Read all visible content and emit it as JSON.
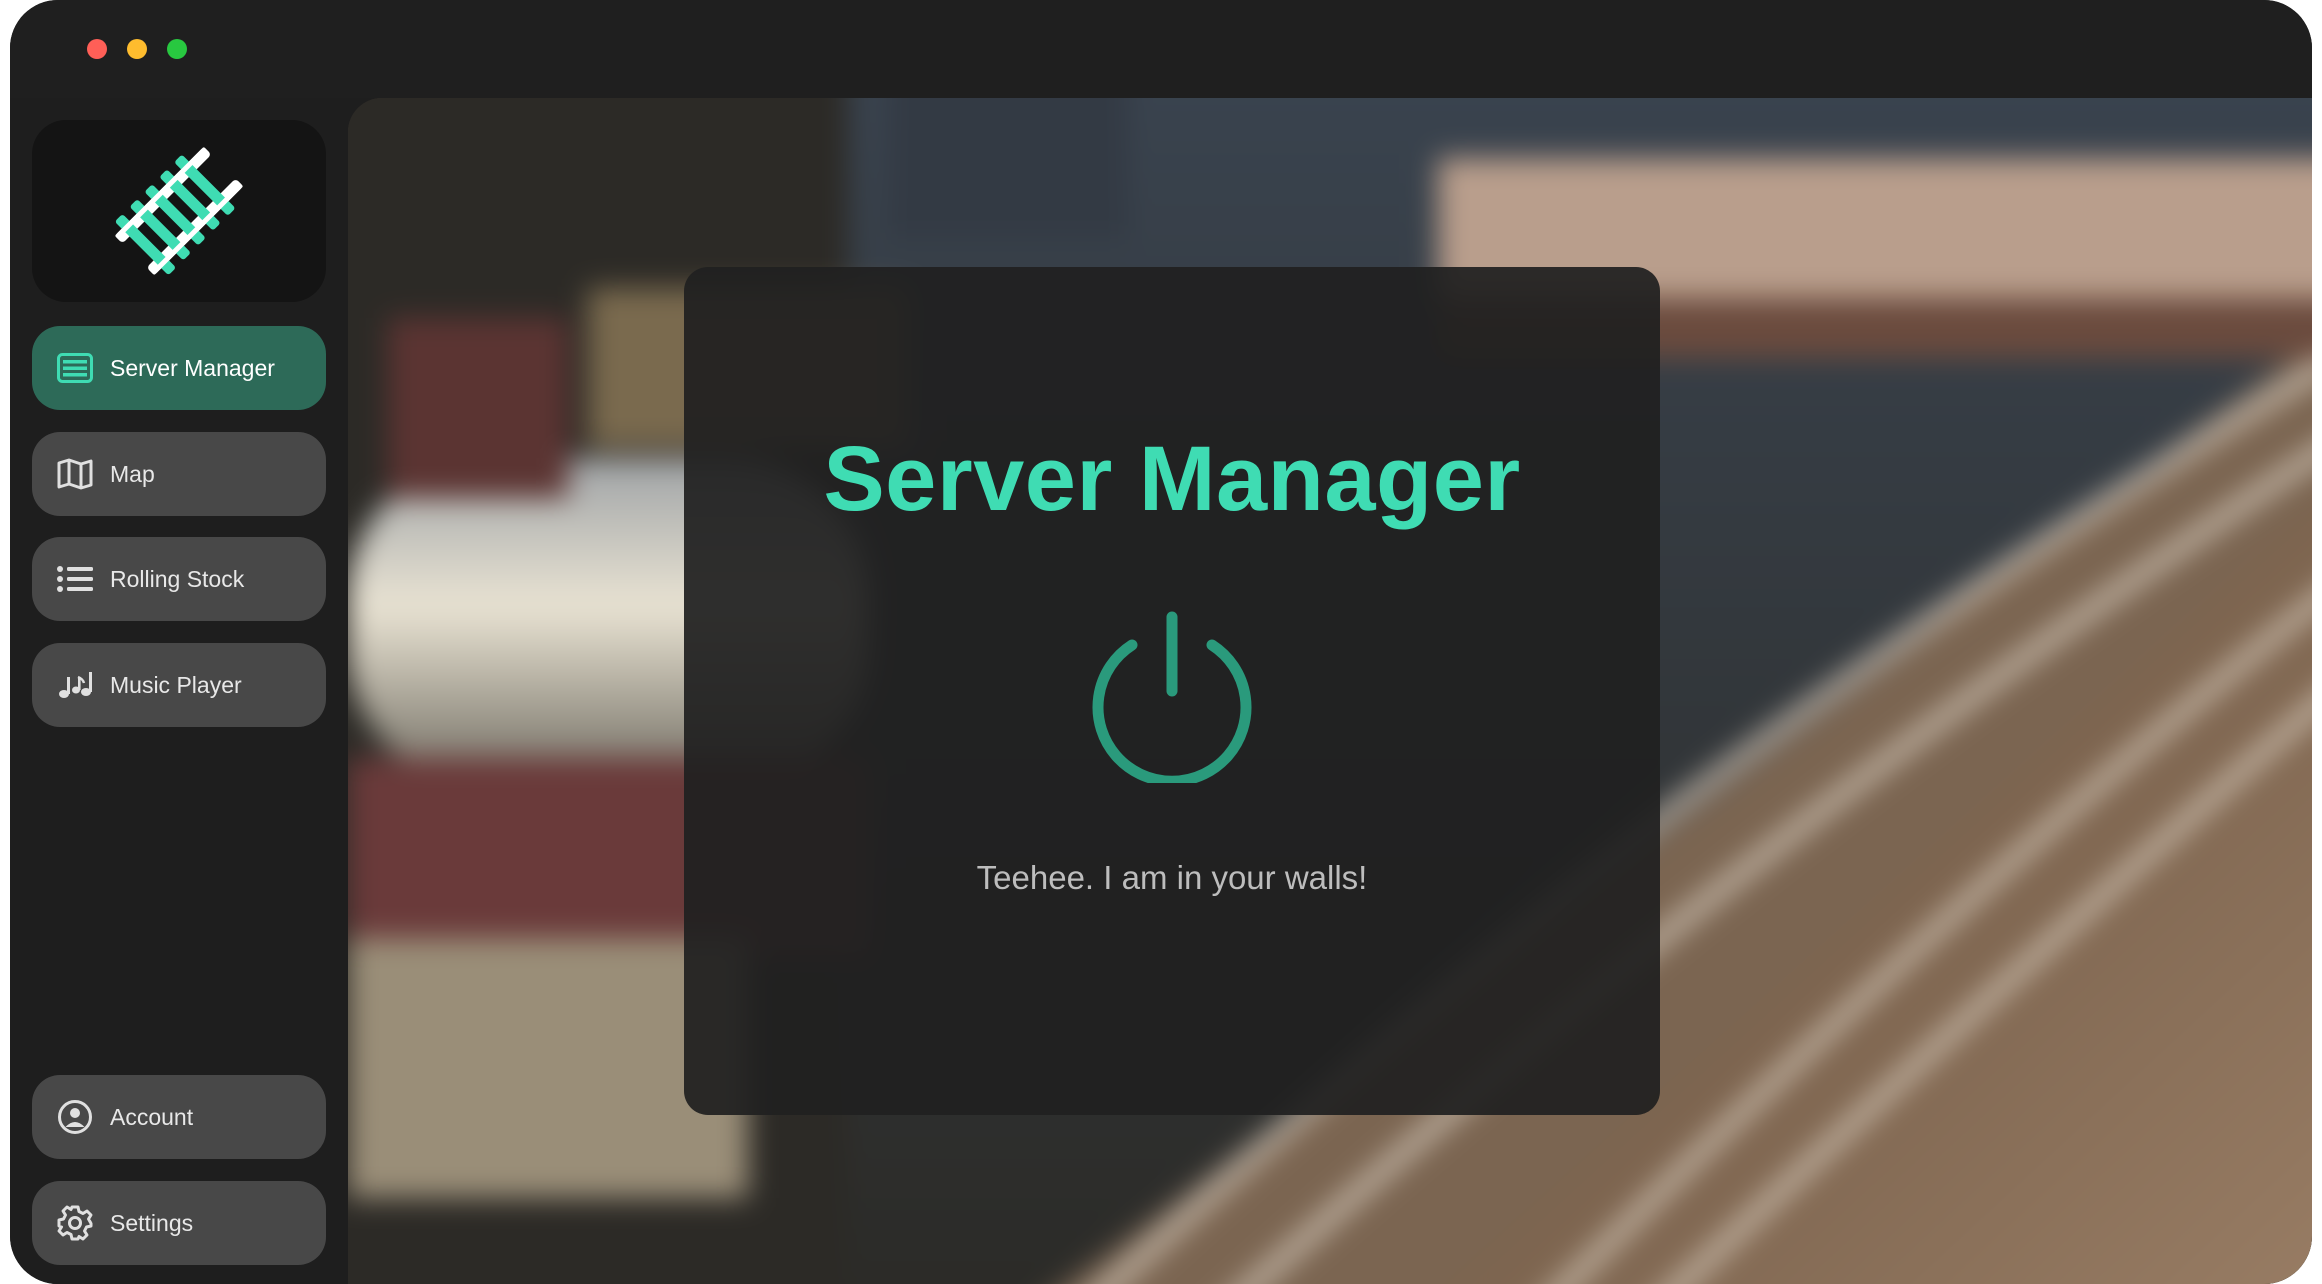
{
  "window": {
    "controls": [
      "close",
      "minimize",
      "maximize"
    ]
  },
  "sidebar": {
    "logo_icon": "railroad-track-icon",
    "nav_items": [
      {
        "label": "Server Manager",
        "icon": "server-list-icon",
        "active": true
      },
      {
        "label": "Map",
        "icon": "map-icon",
        "active": false
      },
      {
        "label": "Rolling Stock",
        "icon": "list-icon",
        "active": false
      },
      {
        "label": "Music Player",
        "icon": "music-notes-icon",
        "active": false
      }
    ],
    "bottom_items": [
      {
        "label": "Account",
        "icon": "account-circle-icon"
      },
      {
        "label": "Settings",
        "icon": "gear-icon"
      }
    ]
  },
  "main": {
    "title": "Server Manager",
    "power_icon": "power-icon",
    "message": "Teehee. I am in your walls!"
  },
  "colors": {
    "accent": "#3fdcb3",
    "active_nav": "#2d6a58",
    "nav_item": "#484848",
    "window_bg": "#1e1e1e",
    "panel_bg": "#202020",
    "power_icon": "#2a9a7c"
  }
}
